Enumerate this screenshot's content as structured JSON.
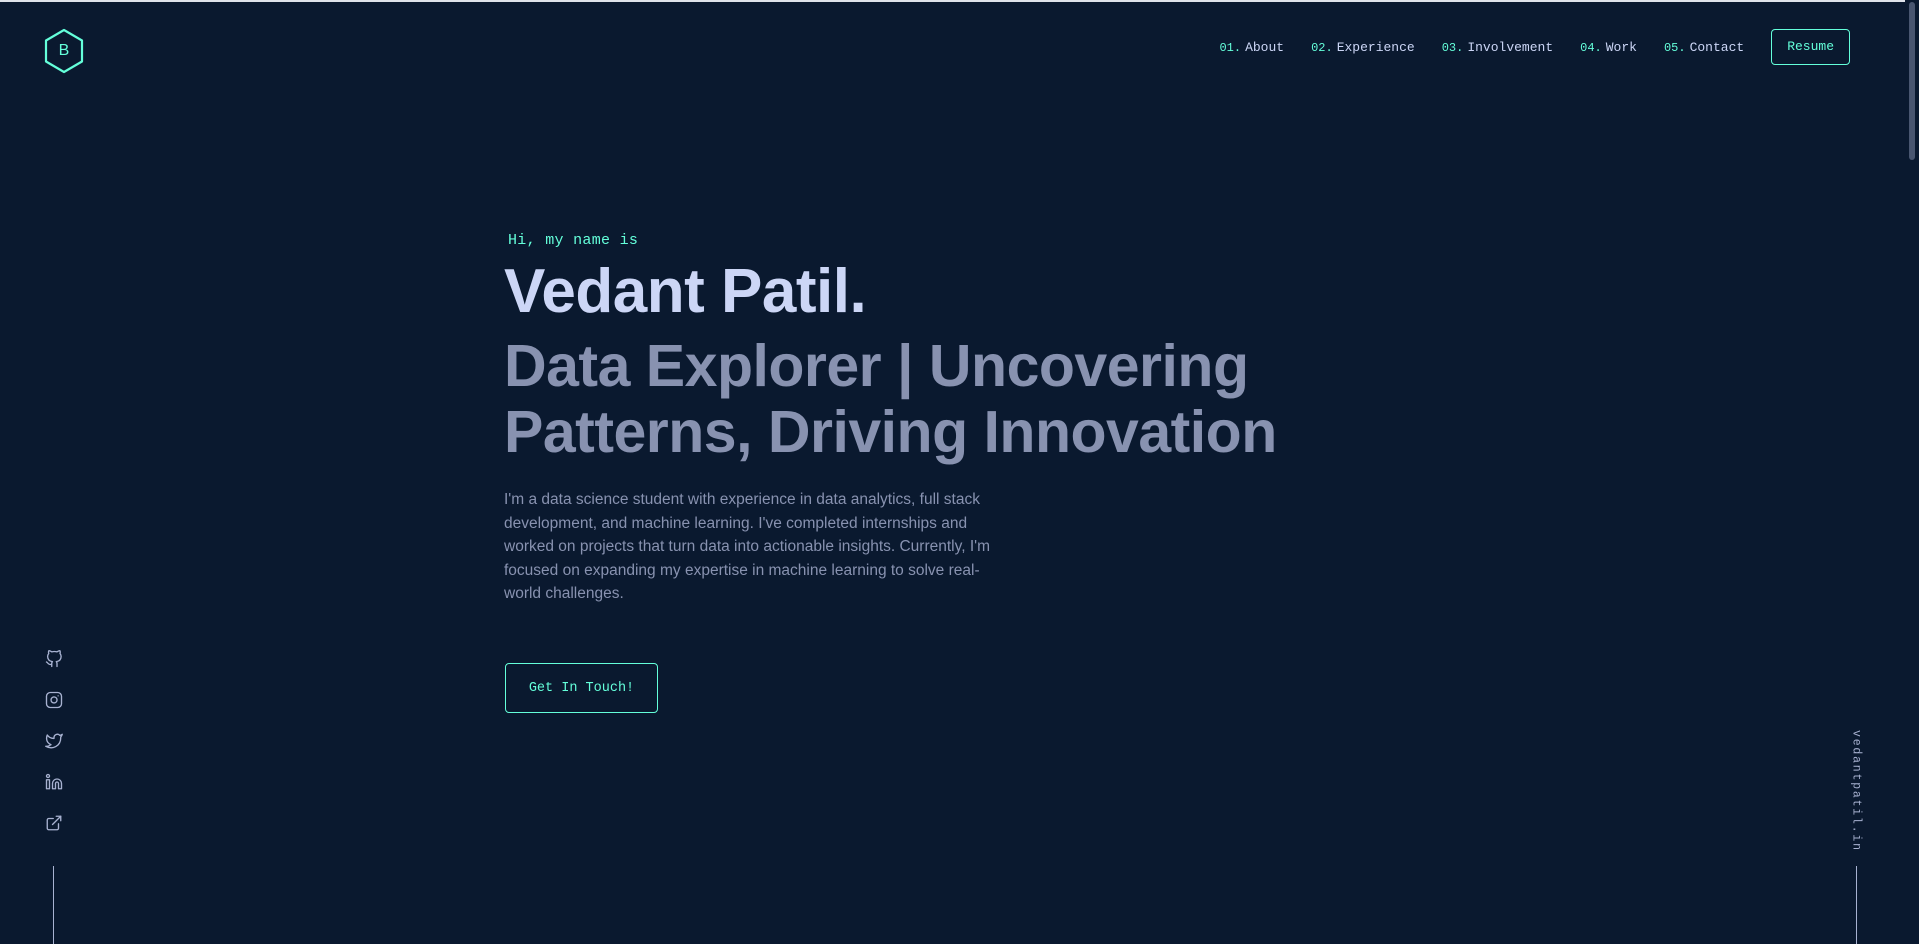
{
  "header": {
    "logo_letter": "B",
    "nav": [
      {
        "num": "01.",
        "label": "About"
      },
      {
        "num": "02.",
        "label": "Experience"
      },
      {
        "num": "03.",
        "label": "Involvement"
      },
      {
        "num": "04.",
        "label": "Work"
      },
      {
        "num": "05.",
        "label": "Contact"
      }
    ],
    "resume_label": "Resume"
  },
  "hero": {
    "greeting": "Hi, my name is",
    "name": "Vedant Patil.",
    "tagline": "Data Explorer | Uncovering Patterns, Driving Innovation",
    "bio": "I'm a data science student with experience in data analytics, full stack development, and machine learning. I've completed internships and worked on projects that turn data into actionable insights. Currently, I'm focused on expanding my expertise in machine learning to solve real-world challenges.",
    "cta_label": "Get In Touch!"
  },
  "social": {
    "icons": [
      "github-icon",
      "instagram-icon",
      "twitter-icon",
      "linkedin-icon",
      "external-link-icon"
    ]
  },
  "email_side": {
    "text": "vedantpatil.in"
  },
  "colors": {
    "background": "#0a192f",
    "accent": "#64ffda",
    "heading": "#ccd6f6",
    "body_text": "#8892b0"
  }
}
